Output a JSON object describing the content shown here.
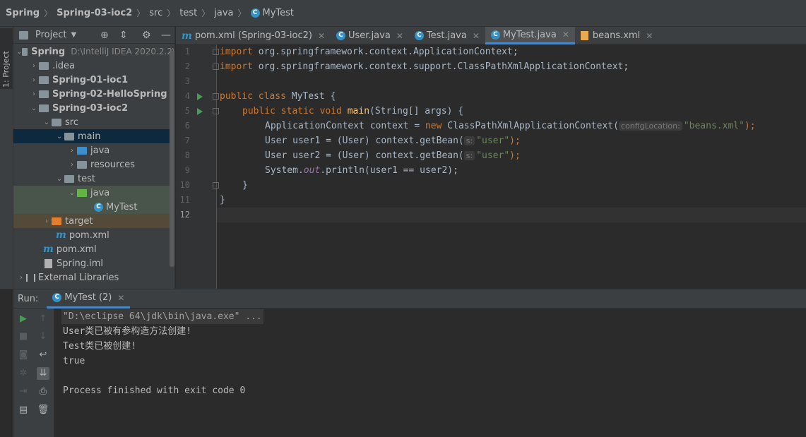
{
  "breadcrumb": [
    {
      "label": "Spring",
      "bold": true
    },
    {
      "label": "Spring-03-ioc2",
      "bold": true
    },
    {
      "label": "src"
    },
    {
      "label": "test"
    },
    {
      "label": "java"
    },
    {
      "label": "MyTest"
    }
  ],
  "left_stripe": {
    "label": "1: Project"
  },
  "project": {
    "title": "Project",
    "tree": [
      {
        "label": "Spring",
        "extra": "D:\\IntelliJ IDEA 2020.2.2\\"
      },
      {
        "label": ".idea"
      },
      {
        "label": "Spring-01-ioc1"
      },
      {
        "label": "Spring-02-HelloSpring"
      },
      {
        "label": "Spring-03-ioc2"
      },
      {
        "label": "src"
      },
      {
        "label": "main"
      },
      {
        "label": "java"
      },
      {
        "label": "resources"
      },
      {
        "label": "test"
      },
      {
        "label": "java"
      },
      {
        "label": "MyTest"
      },
      {
        "label": "target"
      },
      {
        "label": "pom.xml"
      },
      {
        "label": "pom.xml"
      },
      {
        "label": "Spring.iml"
      },
      {
        "label": "External Libraries"
      }
    ]
  },
  "tabs": [
    {
      "label": "pom.xml (Spring-03-ioc2)",
      "icon": "maven-icon"
    },
    {
      "label": "User.java",
      "icon": "class-icon"
    },
    {
      "label": "Test.java",
      "icon": "class-icon"
    },
    {
      "label": "MyTest.java",
      "icon": "class-icon",
      "active": true
    },
    {
      "label": "beans.xml",
      "icon": "xml-file-icon"
    }
  ],
  "editor": {
    "line_numbers": [
      "1",
      "2",
      "3",
      "4",
      "5",
      "6",
      "7",
      "8",
      "9",
      "10",
      "11",
      "12"
    ],
    "code": {
      "l1_kw": "import",
      "l1_rest": " org.springframework.context.ApplicationContext;",
      "l2_kw": "import",
      "l2_rest": " org.springframework.context.support.ClassPathXmlApplicationContext;",
      "l4_kw": "public class",
      "l4_rest": " MyTest {",
      "l5_kw": "public static void",
      "l5_fn": "main",
      "l5_rest": "(String[] args) {",
      "l6_a": "ApplicationContext context = ",
      "l6_kw": "new",
      "l6_b": " ClassPathXmlApplicationContext(",
      "l6_hint": "configLocation:",
      "l6_str": "\"beans.xml\"",
      "l6_end": ");",
      "l7_a": "User user1 = (User) context.getBean(",
      "l7_hint": "s:",
      "l7_str": "\"user\"",
      "l7_end": ");",
      "l8_a": "User user2 = (User) context.getBean(",
      "l8_hint": "s:",
      "l8_str": "\"user\"",
      "l8_end": ");",
      "l9_a": "System.",
      "l9_fld": "out",
      "l9_b": ".println(user1 == user2);",
      "l10": "}",
      "l11": "}"
    }
  },
  "run": {
    "label": "Run:",
    "tab": "MyTest (2)",
    "console": [
      "\"D:\\eclipse 64\\jdk\\bin\\java.exe\" ...",
      "User类已被有参构造方法创建!",
      "Test类已被创建!",
      "true",
      "",
      "Process finished with exit code 0"
    ]
  },
  "colors": {
    "keyword": "#cc7832",
    "method": "#ffc66d",
    "string": "#6a8759",
    "field": "#9876aa",
    "accent": "#4a88c7",
    "run_green": "#499c54"
  }
}
